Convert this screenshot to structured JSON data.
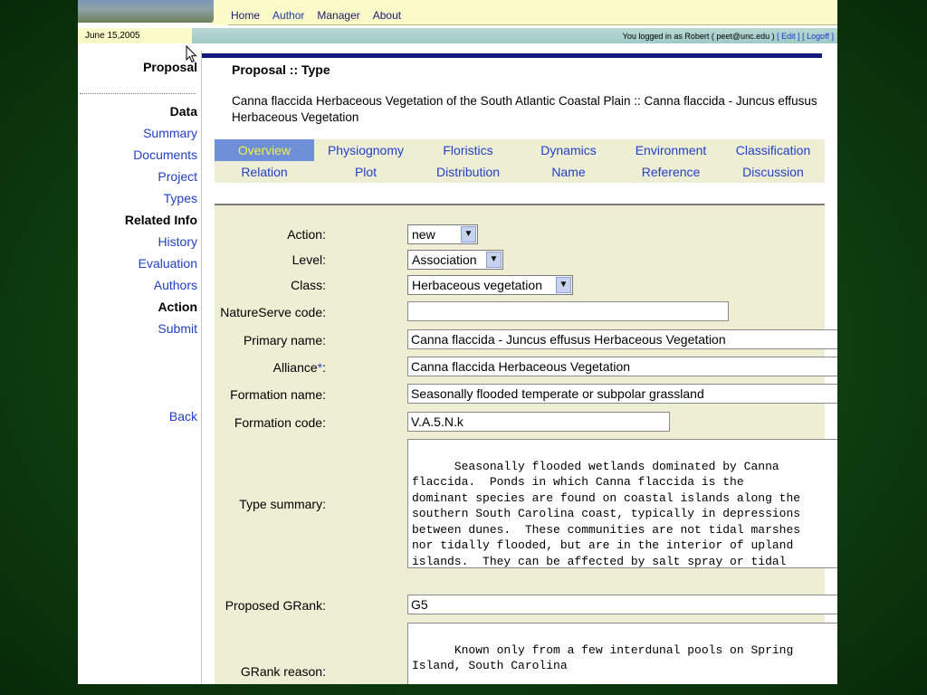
{
  "header": {
    "nav": [
      "Home",
      "Author",
      "Manager",
      "About"
    ],
    "active_nav": "Author",
    "date": "June 15,2005",
    "status": {
      "prefix": "You logged in as Robert ( peet@unc.edu ) ",
      "edit": "[ Edit ]",
      "logoff": "[ Logoff ]"
    }
  },
  "sidebar": {
    "proposal": "Proposal",
    "data_head": "Data",
    "data_links": [
      "Summary",
      "Documents",
      "Project",
      "Types"
    ],
    "related_head": "Related Info",
    "related_links": [
      "History",
      "Evaluation",
      "Authors"
    ],
    "action_head": "Action",
    "action_links": [
      "Submit"
    ],
    "back": "Back"
  },
  "main": {
    "title": "Proposal :: Type",
    "subtitle": "Canna flaccida Herbaceous Vegetation of the South Atlantic Coastal Plain :: Canna flaccida - Juncus effusus Herbaceous Vegetation",
    "tabs": [
      [
        "Overview",
        "Physiognomy",
        "Floristics",
        "Dynamics",
        "Environment",
        "Classification"
      ],
      [
        "Relation",
        "Plot",
        "Distribution",
        "Name",
        "Reference",
        "Discussion"
      ]
    ],
    "active_tab": "Overview"
  },
  "form": {
    "action": {
      "label": "Action:",
      "value": "new"
    },
    "level": {
      "label": "Level:",
      "value": "Association"
    },
    "class": {
      "label": "Class:",
      "value": "Herbaceous vegetation"
    },
    "natureserve_code": {
      "label": "NatureServe code:",
      "value": ""
    },
    "primary_name": {
      "label": "Primary name:",
      "value": "Canna flaccida - Juncus effusus Herbaceous Vegetation"
    },
    "alliance": {
      "label": "Alliance",
      "star": "*",
      "colon": ":",
      "value": "Canna flaccida Herbaceous Vegetation"
    },
    "formation_name": {
      "label": "Formation name:",
      "value": "Seasonally flooded temperate or subpolar grassland"
    },
    "formation_code": {
      "label": "Formation code:",
      "value": "V.A.5.N.k"
    },
    "type_summary": {
      "label": "Type summary:",
      "value": "Seasonally flooded wetlands dominated by Canna\nflaccida.  Ponds in which Canna flaccida is the\ndominant species are found on coastal islands along the\nsouthern South Carolina coast, typically in depressions\nbetween dunes.  These communities are not tidal marshes\nnor tidally flooded, but are in the interior of upland\nislands.  They can be affected by salt spray or tidal\nflooding during extreme events. Other common co-"
    },
    "proposed_grank": {
      "label": "Proposed GRank:",
      "value": "G5"
    },
    "grank_reason": {
      "label": "GRank reason:",
      "value": "Known only from a few interdunal pools on Spring\nIsland, South Carolina"
    }
  },
  "colors": {
    "accent_rule": "#13197f",
    "tab_active_bg": "#6f8fd8",
    "tab_active_text": "#f2f246",
    "link": "#2340c8",
    "form_bg": "#eeeed4"
  },
  "icons": [
    "dropdown-arrow-icon",
    "scroll-up-icon",
    "scroll-down-icon",
    "mouse-cursor-icon"
  ]
}
